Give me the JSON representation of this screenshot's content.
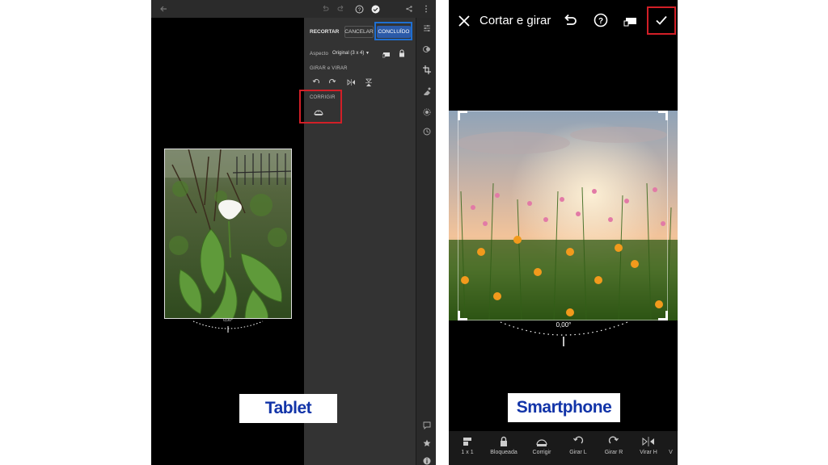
{
  "tablet": {
    "caption": "Tablet",
    "panel": {
      "title": "RECORTAR",
      "cancel_label": "CANCELAR",
      "done_label": "CONCLUÍDO",
      "aspect_label": "Aspecto",
      "aspect_value": "Original (3 x 4)",
      "rotate_flip_label": "GIRAR e VIRAR",
      "straighten_label": "CORRIGIR"
    },
    "angle_readout": "0,00°"
  },
  "phone": {
    "caption": "Smartphone",
    "title": "Cortar e girar",
    "angle_readout": "0,00°",
    "bottom_tools": [
      {
        "label": "1 x 1",
        "icon": "aspect-icon"
      },
      {
        "label": "Bloqueada",
        "icon": "lock-icon"
      },
      {
        "label": "Corrigir",
        "icon": "auto-straighten-icon"
      },
      {
        "label": "Girar L",
        "icon": "rotate-left-icon"
      },
      {
        "label": "Girar R",
        "icon": "rotate-right-icon"
      },
      {
        "label": "Virar H",
        "icon": "flip-horizontal-icon"
      },
      {
        "label": "V",
        "icon": "flip-vertical-icon"
      }
    ]
  },
  "colors": {
    "highlight_red": "#d21f27",
    "highlight_blue": "#1f6fd1",
    "caption_text": "#1234a8"
  }
}
